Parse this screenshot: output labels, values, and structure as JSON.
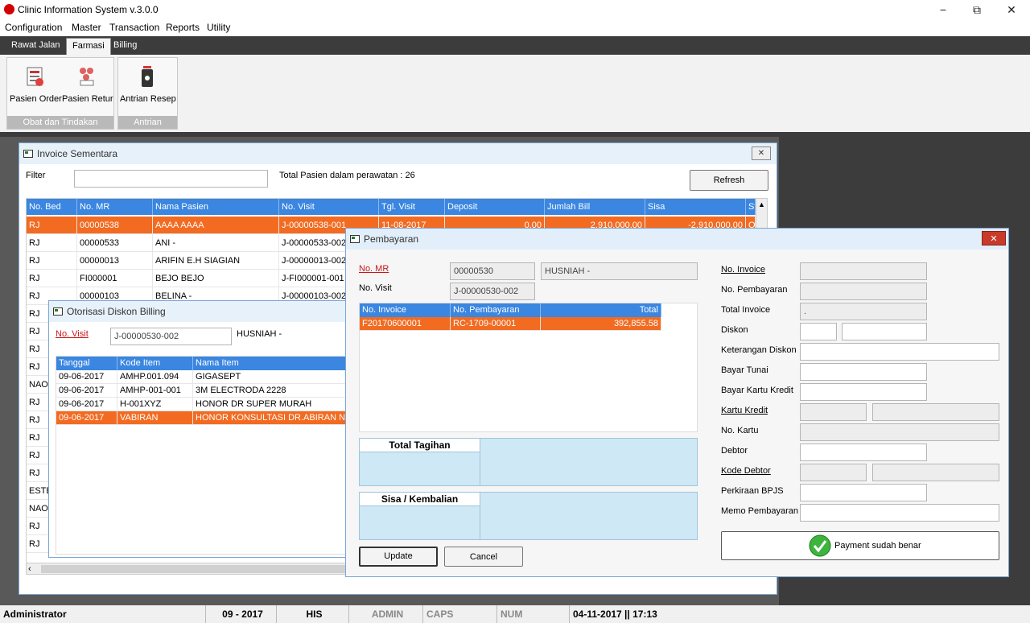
{
  "app": {
    "title": "Clinic Information System v.3.0.0",
    "window_controls": {
      "minimize": "−",
      "maximize": "⧉",
      "close": "✕"
    }
  },
  "menu": [
    "Configuration",
    "Master",
    "Transaction",
    "Reports",
    "Utility"
  ],
  "ribbon": {
    "tabs": [
      "Rawat Jalan",
      "Farmasi",
      "Billing"
    ],
    "active_tab": "Farmasi",
    "groups": [
      {
        "label": "Obat dan Tindakan",
        "buttons": [
          "Pasien Order",
          "Pasien Retur"
        ]
      },
      {
        "label": "Antrian",
        "buttons": [
          "Antrian Resep"
        ]
      }
    ]
  },
  "invoice_window": {
    "title": "Invoice Sementara",
    "filter_label": "Filter",
    "filter_value": "",
    "total_label": "Total Pasien dalam perawatan : 26",
    "refresh_label": "Refresh",
    "columns": [
      "No. Bed",
      "No. MR",
      "Nama Pasien",
      "No. Visit",
      "Tgl. Visit",
      "Deposit",
      "Jumlah Bill",
      "Sisa",
      "St"
    ],
    "rows": [
      [
        "RJ",
        "00000538",
        "AAAA AAAA",
        "J-00000538-001",
        "11-08-2017",
        "0.00",
        "2,910,000.00",
        "-2,910,000.00",
        "O"
      ],
      [
        "RJ",
        "00000533",
        "ANI -",
        "J-00000533-002",
        "",
        "",
        "",
        "",
        ""
      ],
      [
        "RJ",
        "00000013",
        "ARIFIN E.H SIAGIAN",
        "J-00000013-002",
        "",
        "",
        "",
        "",
        ""
      ],
      [
        "RJ",
        "FI000001",
        "BEJO BEJO",
        "J-FI000001-001",
        "",
        "",
        "",
        "",
        ""
      ],
      [
        "RJ",
        "00000103",
        "BELINA -",
        "J-00000103-002",
        "",
        "",
        "",
        "",
        ""
      ]
    ],
    "bed_column_rest": [
      "RJ",
      "RJ",
      "RJ",
      "RJ",
      "NAOM",
      "RJ",
      "RJ",
      "RJ",
      "RJ",
      "RJ",
      "ESTE",
      "NAOM",
      "RJ",
      "RJ"
    ]
  },
  "discount_window": {
    "title": "Otorisasi Diskon Billing",
    "visit_label": "No. Visit",
    "visit_value": "J-00000530-002",
    "patient_name": "HUSNIAH -",
    "columns": [
      "Tanggal",
      "Kode Item",
      "Nama Item"
    ],
    "rows": [
      [
        "09-06-2017",
        "AMHP.001.094",
        "GIGASEPT"
      ],
      [
        "09-06-2017",
        "AMHP-001-001",
        "3M ELECTRODA 2228"
      ],
      [
        "09-06-2017",
        "H-001XYZ",
        "HONOR DR SUPER MURAH"
      ],
      [
        "09-06-2017",
        "VABIRAN",
        "HONOR KONSULTASI DR.ABIRAN NABAE"
      ]
    ]
  },
  "payment_window": {
    "title": "Pembayaran",
    "no_mr_label": "No. MR",
    "no_mr_value": "00000530",
    "patient_name": "HUSNIAH -",
    "no_visit_label": "No. Visit",
    "no_visit_value": "J-00000530-002",
    "columns": [
      "No. Invoice",
      "No. Pembayaran",
      "Total"
    ],
    "rows": [
      [
        "F20170600001",
        "RC-1709-00001",
        "392,855.58"
      ]
    ],
    "total_tagihan_label": "Total Tagihan",
    "sisa_label": "Sisa / Kembalian",
    "update_label": "Update",
    "cancel_label": "Cancel",
    "fields": {
      "no_invoice": "No. Invoice",
      "no_pembayaran": "No. Pembayaran",
      "total_invoice": "Total Invoice",
      "total_invoice_value": ".",
      "diskon": "Diskon",
      "keterangan_diskon": "Keterangan Diskon",
      "bayar_tunai": "Bayar Tunai",
      "bayar_kartu_kredit": "Bayar Kartu Kredit",
      "kartu_kredit": "Kartu Kredit",
      "no_kartu": "No. Kartu",
      "debtor": "Debtor",
      "kode_debtor": "Kode Debtor",
      "perkiraan_bpjs": "Perkiraan BPJS",
      "memo_pembayaran": "Memo Pembayaran"
    },
    "payment_ok_label": "Payment sudah benar"
  },
  "status": {
    "user": "Administrator",
    "period": "09 - 2017",
    "app_code": "HIS",
    "role": "ADMIN",
    "caps": "CAPS",
    "num": "NUM",
    "datetime": "04-11-2017 || 17:13"
  },
  "colors": {
    "selection": "#f26b21",
    "header": "#3a86e0",
    "panel": "#cfe8f5"
  }
}
